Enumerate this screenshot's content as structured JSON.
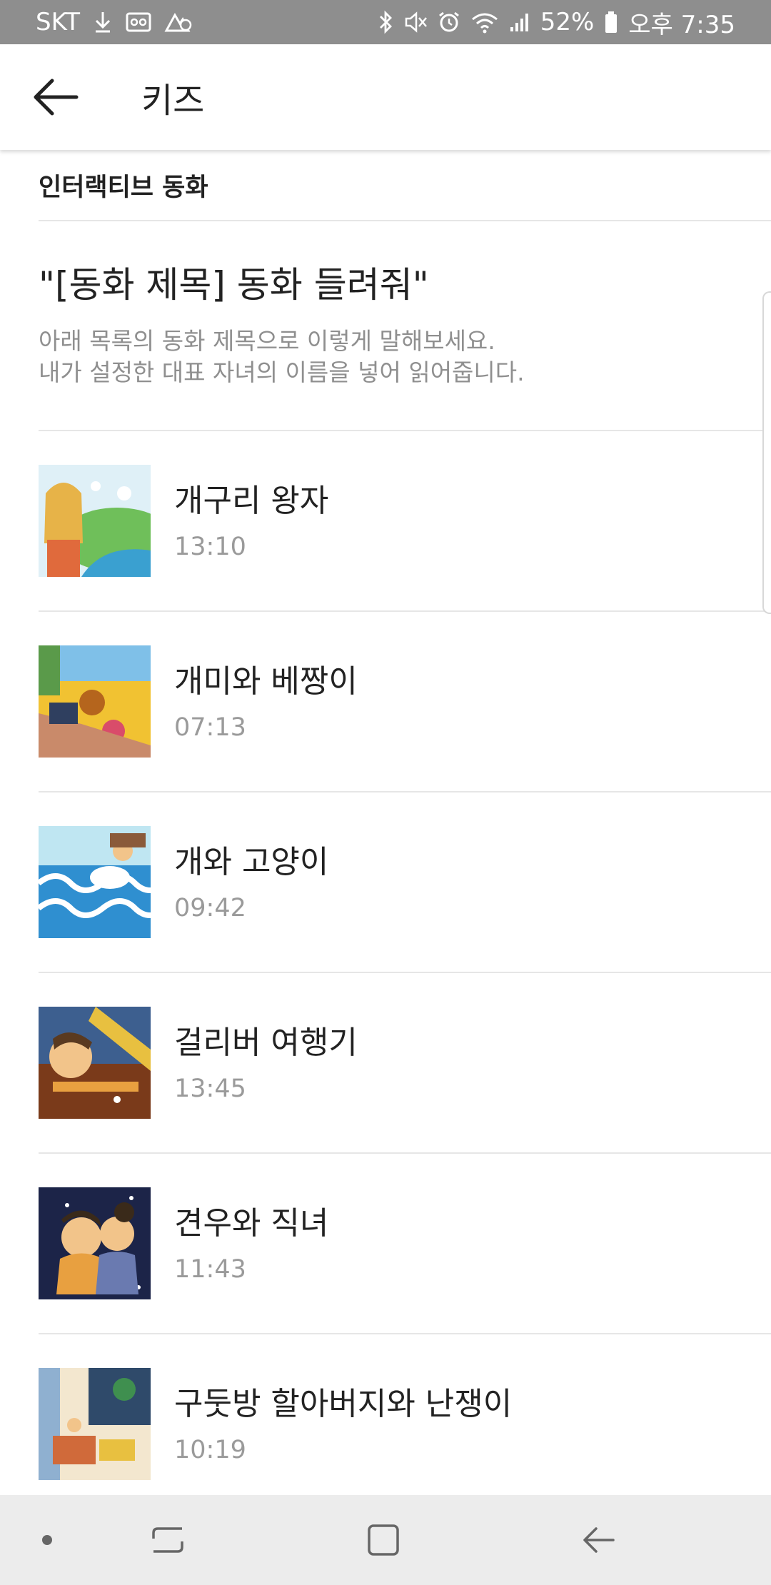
{
  "status_bar": {
    "carrier": "SKT",
    "battery": "52%",
    "time": "오후 7:35"
  },
  "app_bar": {
    "title": "키즈"
  },
  "section": {
    "header": "인터랙티브 동화"
  },
  "intro": {
    "title": "\"[동화 제목] 동화 들려줘\"",
    "description": "아래 목록의 동화 제목으로 이렇게 말해보세요.\n내가 설정한 대표 자녀의 이름을 넣어 읽어줍니다."
  },
  "stories": [
    {
      "title": "개구리 왕자",
      "duration": "13:10"
    },
    {
      "title": "개미와 베짱이",
      "duration": "07:13"
    },
    {
      "title": "개와 고양이",
      "duration": "09:42"
    },
    {
      "title": "걸리버 여행기",
      "duration": "13:45"
    },
    {
      "title": "견우와 직녀",
      "duration": "11:43"
    },
    {
      "title": "구둣방 할아버지와 난쟁이",
      "duration": "10:19"
    }
  ],
  "colors": {
    "status_bar_bg": "#8e8e8e",
    "nav_bar_bg": "#ececec",
    "divider": "#e6e6e6",
    "secondary_text": "#8f8f8f"
  }
}
